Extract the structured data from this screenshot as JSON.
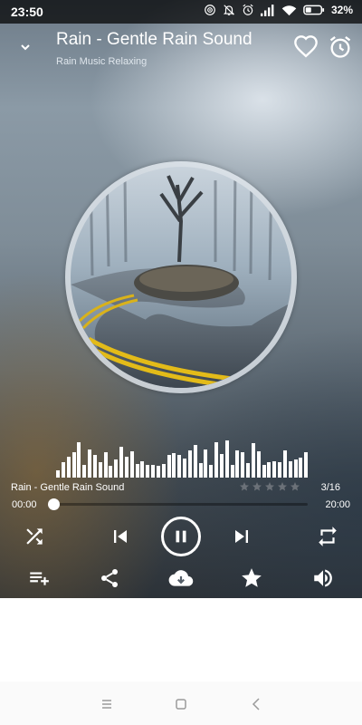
{
  "status_bar": {
    "time": "23:50",
    "battery": "32%",
    "icons": [
      "hotspot-icon",
      "mute-bell-icon",
      "alarm-icon",
      "signal-icon",
      "wifi-icon",
      "battery-icon"
    ]
  },
  "header": {
    "title": "Rain - Gentle Rain Sound",
    "artist": "Rain Music Relaxing",
    "icons": [
      "chevron-down-icon",
      "heart-icon",
      "alarm-clock-icon"
    ]
  },
  "now_playing": {
    "track_name": "Rain - Gentle Rain Sound",
    "track_index": "3/16",
    "rating": 0,
    "rating_max": 5,
    "current_time": "00:00",
    "total_time": "20:00",
    "progress": 0.0,
    "visualizer_levels": [
      0.18,
      0.38,
      0.52,
      0.62,
      0.86,
      0.32,
      0.7,
      0.55,
      0.38,
      0.62,
      0.28,
      0.45,
      0.76,
      0.5,
      0.64,
      0.34,
      0.4,
      0.3,
      0.32,
      0.28,
      0.34,
      0.55,
      0.6,
      0.55,
      0.46,
      0.66,
      0.8,
      0.36,
      0.7,
      0.3,
      0.86,
      0.58,
      0.92,
      0.3,
      0.66,
      0.62,
      0.36,
      0.84,
      0.64,
      0.32,
      0.38,
      0.4,
      0.38,
      0.66,
      0.4,
      0.44,
      0.48,
      0.62
    ]
  },
  "controls": {
    "icons": [
      "shuffle-icon",
      "skip-previous-icon",
      "pause-icon",
      "skip-next-icon",
      "repeat-icon"
    ]
  },
  "actions": {
    "icons": [
      "playlist-add-icon",
      "share-icon",
      "cloud-download-icon",
      "star-icon",
      "volume-icon"
    ]
  },
  "nav_bar": {
    "icons": [
      "menu-icon",
      "home-square-icon",
      "back-icon"
    ]
  },
  "colors": {
    "accent": "#ffffff",
    "status_bar": "#111111",
    "nav_bar": "#fafafa",
    "star_empty": "#6b7178"
  }
}
